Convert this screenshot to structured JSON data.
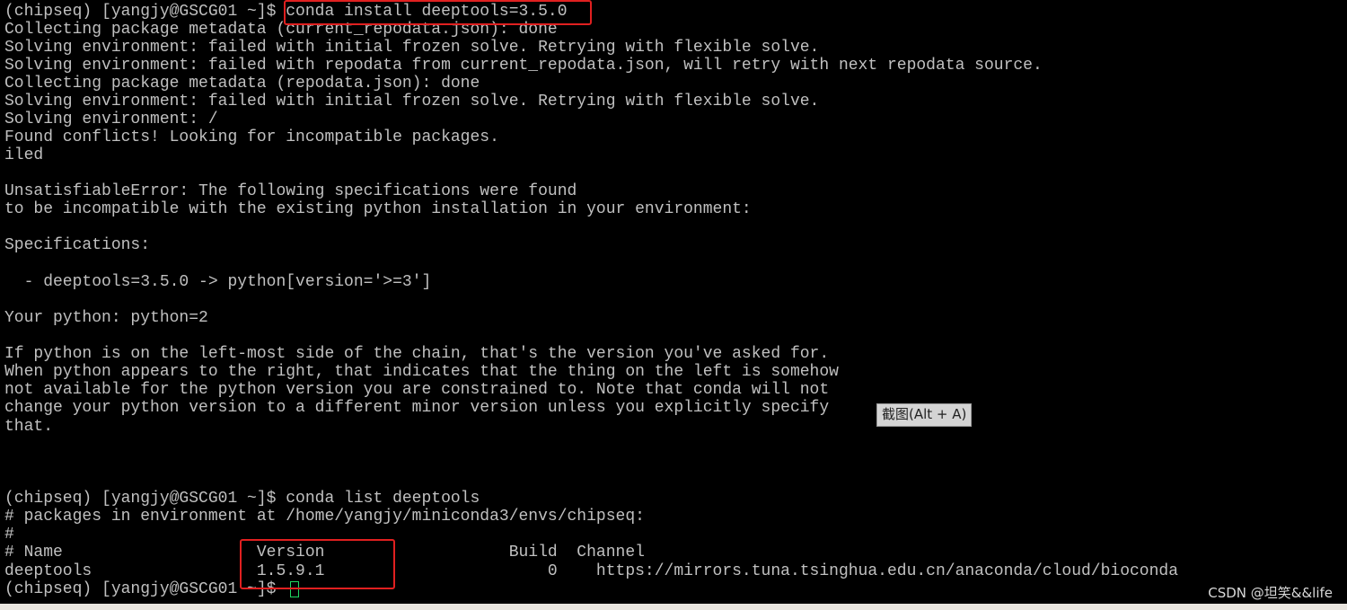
{
  "terminal": {
    "lines": [
      "(chipseq) [yangjy@GSCG01 ~]$ conda install deeptools=3.5.0",
      "Collecting package metadata (current_repodata.json): done",
      "Solving environment: failed with initial frozen solve. Retrying with flexible solve.",
      "Solving environment: failed with repodata from current_repodata.json, will retry with next repodata source.",
      "Collecting package metadata (repodata.json): done",
      "Solving environment: failed with initial frozen solve. Retrying with flexible solve.",
      "Solving environment: /",
      "Found conflicts! Looking for incompatible packages.",
      "iled",
      "",
      "UnsatisfiableError: The following specifications were found",
      "to be incompatible with the existing python installation in your environment:",
      "",
      "Specifications:",
      "",
      "  - deeptools=3.5.0 -> python[version='>=3']",
      "",
      "Your python: python=2",
      "",
      "If python is on the left-most side of the chain, that's the version you've asked for.",
      "When python appears to the right, that indicates that the thing on the left is somehow",
      "not available for the python version you are constrained to. Note that conda will not",
      "change your python version to a different minor version unless you explicitly specify",
      "that.",
      "",
      "",
      "",
      "(chipseq) [yangjy@GSCG01 ~]$ conda list deeptools",
      "# packages in environment at /home/yangjy/miniconda3/envs/chipseq:",
      "#",
      "# Name                    Version                   Build  Channel",
      "deeptools                 1.5.9.1                       0    https://mirrors.tuna.tsinghua.edu.cn/anaconda/cloud/bioconda",
      "(chipseq) [yangjy@GSCG01 ~]$ "
    ],
    "text_color": "#c0c0c0",
    "background": "#000000",
    "cursor_color": "#1ed760"
  },
  "annotations": {
    "highlight_color": "#e02020"
  },
  "tooltip": {
    "text": "截图(Alt + A)"
  },
  "watermark": {
    "text": "CSDN @坦笑&&life"
  }
}
